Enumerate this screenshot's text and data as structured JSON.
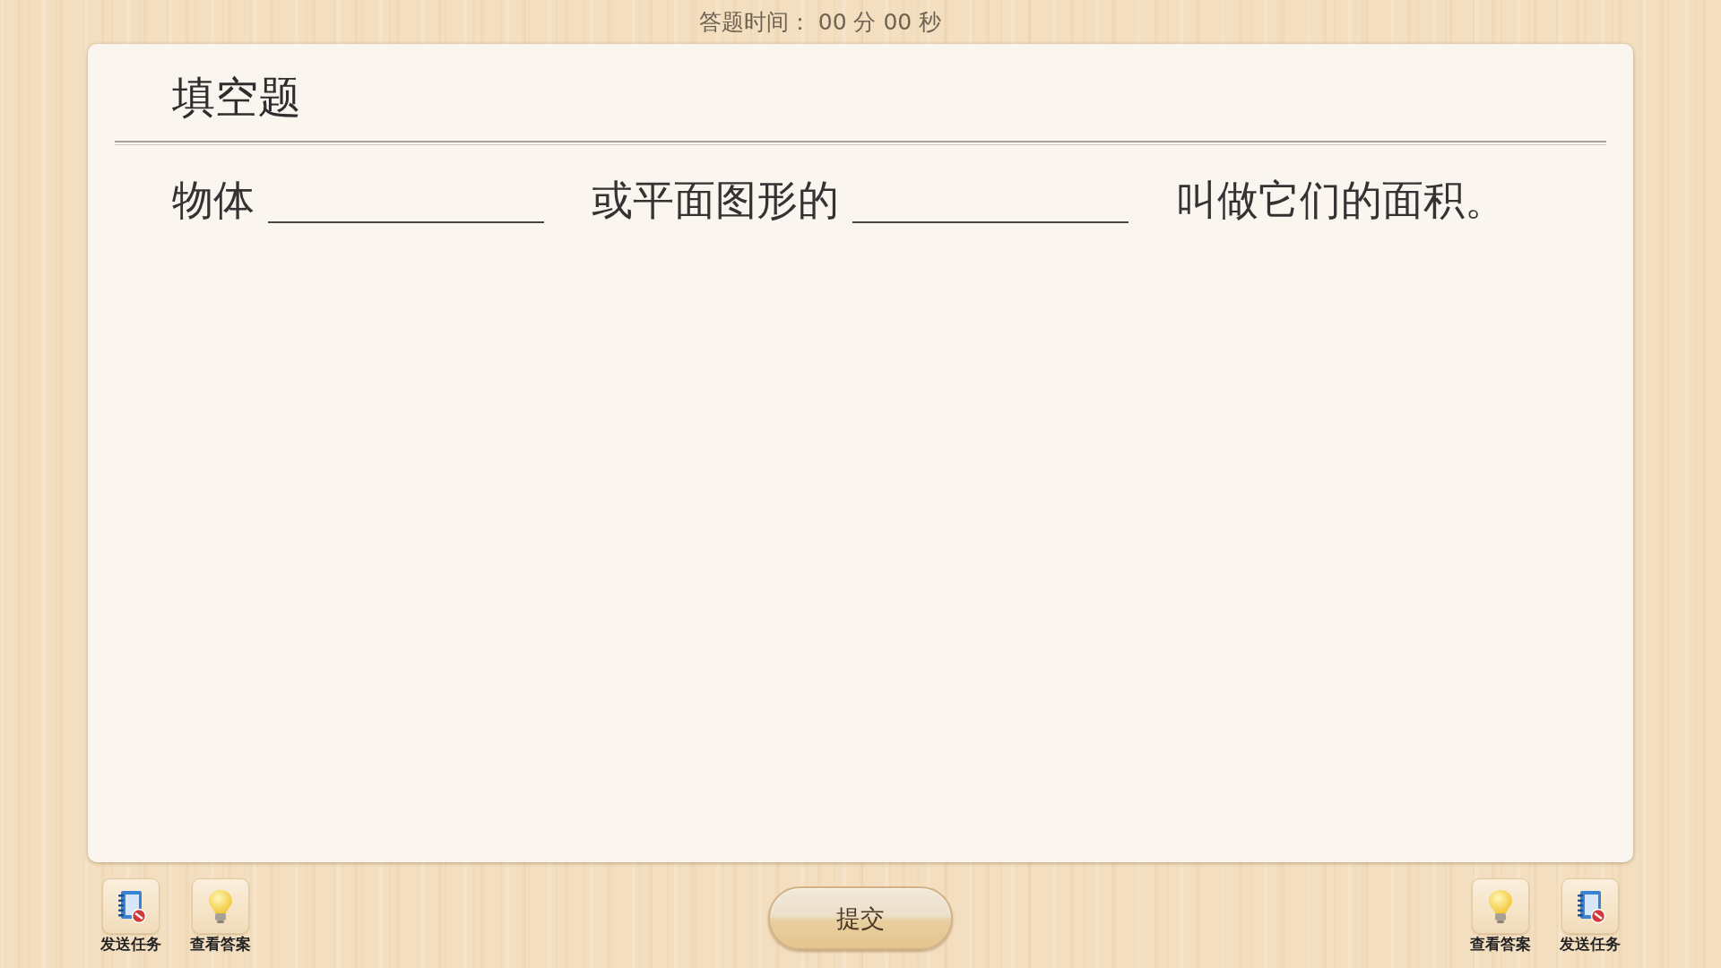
{
  "timer": "答题时间： 00 分 00 秒",
  "question": {
    "type_title": "填空题",
    "segments": [
      {
        "kind": "text",
        "text": "物体"
      },
      {
        "kind": "blank"
      },
      {
        "kind": "text",
        "text": "或平面图形的"
      },
      {
        "kind": "blank"
      },
      {
        "kind": "text",
        "text": "叫做它们的面积。"
      }
    ]
  },
  "toolbar_left": [
    {
      "kind": "send",
      "label": "发送任务"
    },
    {
      "kind": "answer",
      "label": "查看答案"
    }
  ],
  "submit_button": "提交",
  "toolbar_right": [
    {
      "kind": "answer",
      "label": "查看答案"
    },
    {
      "kind": "send",
      "label": "发送任务"
    }
  ]
}
